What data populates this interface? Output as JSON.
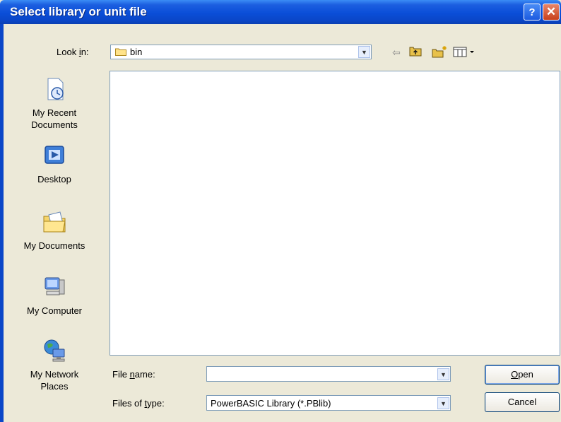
{
  "window": {
    "title": "Select library or unit file",
    "help_icon": "question-mark",
    "close_icon": "x"
  },
  "lookin": {
    "label_pre": "Look ",
    "label_accel": "i",
    "label_post": "n:",
    "value": "bin",
    "icons": [
      "back-arrow-icon",
      "up-folder-icon",
      "new-folder-icon",
      "view-menu-icon"
    ]
  },
  "places": [
    {
      "line1": "My Recent",
      "line2": "Documents",
      "icon": "recent-documents-icon"
    },
    {
      "line1": "Desktop",
      "line2": "",
      "icon": "desktop-icon"
    },
    {
      "line1": "My Documents",
      "line2": "",
      "icon": "my-documents-icon"
    },
    {
      "line1": "My Computer",
      "line2": "",
      "icon": "my-computer-icon"
    },
    {
      "line1": "My Network",
      "line2": "Places",
      "icon": "network-places-icon"
    }
  ],
  "filename": {
    "label_pre": "File ",
    "label_accel": "n",
    "label_post": "ame:",
    "value": ""
  },
  "filetype": {
    "label_pre": "Files of ",
    "label_accel": "t",
    "label_post": "ype:",
    "value": "PowerBASIC Library (*.PBlib)"
  },
  "buttons": {
    "open_accel": "O",
    "open_rest": "pen",
    "cancel": "Cancel"
  },
  "colors": {
    "title_bar": "#0a46c8",
    "dialog_bg": "#ece9d8",
    "field_border": "#7f9db9"
  }
}
